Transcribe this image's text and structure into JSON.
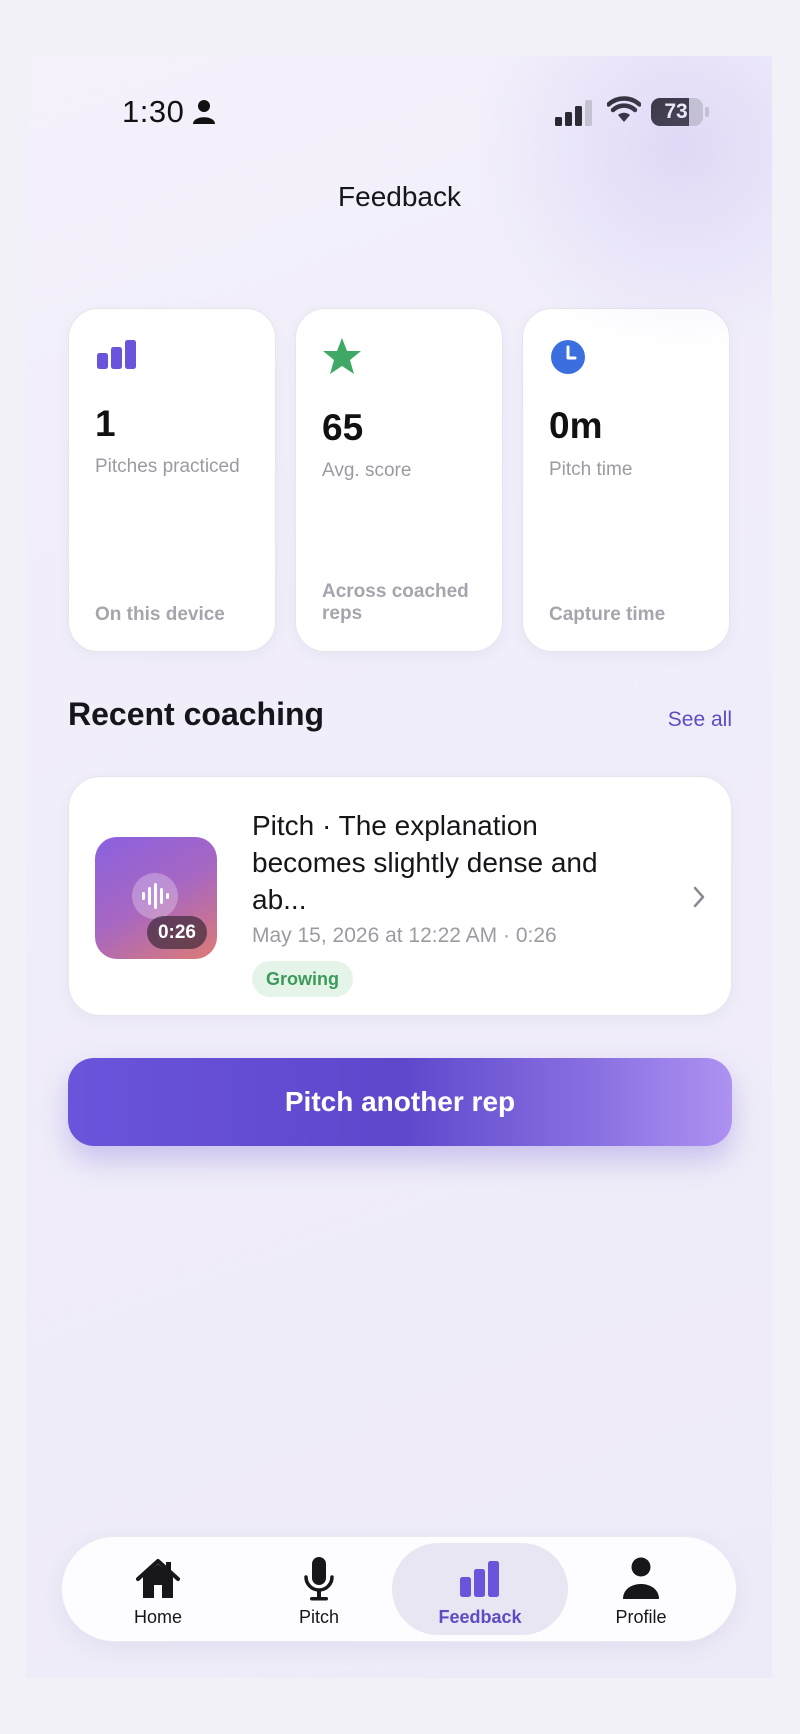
{
  "status_bar": {
    "time": "1:30",
    "battery": 73,
    "battery_label": "73"
  },
  "header": {
    "title": "Feedback"
  },
  "stats": [
    {
      "icon": "bar-chart-icon",
      "value": "1",
      "label": "Pitches practiced",
      "foot": "On this device",
      "color": "#6a54db"
    },
    {
      "icon": "star-icon",
      "value": "65",
      "label": "Avg. score",
      "foot": "Across coached reps",
      "color": "#3fa866"
    },
    {
      "icon": "clock-icon",
      "value": "0m",
      "label": "Pitch time",
      "foot": "Capture time",
      "color": "#3b6fe0"
    }
  ],
  "recent": {
    "title": "Recent coaching",
    "see_all": "See all",
    "items": [
      {
        "title": "Pitch · The explanation becomes slightly dense and ab...",
        "meta": "May 15, 2026 at 12:22 AM · 0:26",
        "duration": "0:26",
        "status": "Growing"
      }
    ]
  },
  "cta": {
    "label": "Pitch another rep"
  },
  "tabs": [
    {
      "label": "Home",
      "icon": "home-icon",
      "active": false
    },
    {
      "label": "Pitch",
      "icon": "microphone-icon",
      "active": false
    },
    {
      "label": "Feedback",
      "icon": "bar-chart-icon",
      "active": true
    },
    {
      "label": "Profile",
      "icon": "person-icon",
      "active": false
    }
  ],
  "colors": {
    "accent": "#5e4cc2",
    "success": "#3c9a5c"
  }
}
